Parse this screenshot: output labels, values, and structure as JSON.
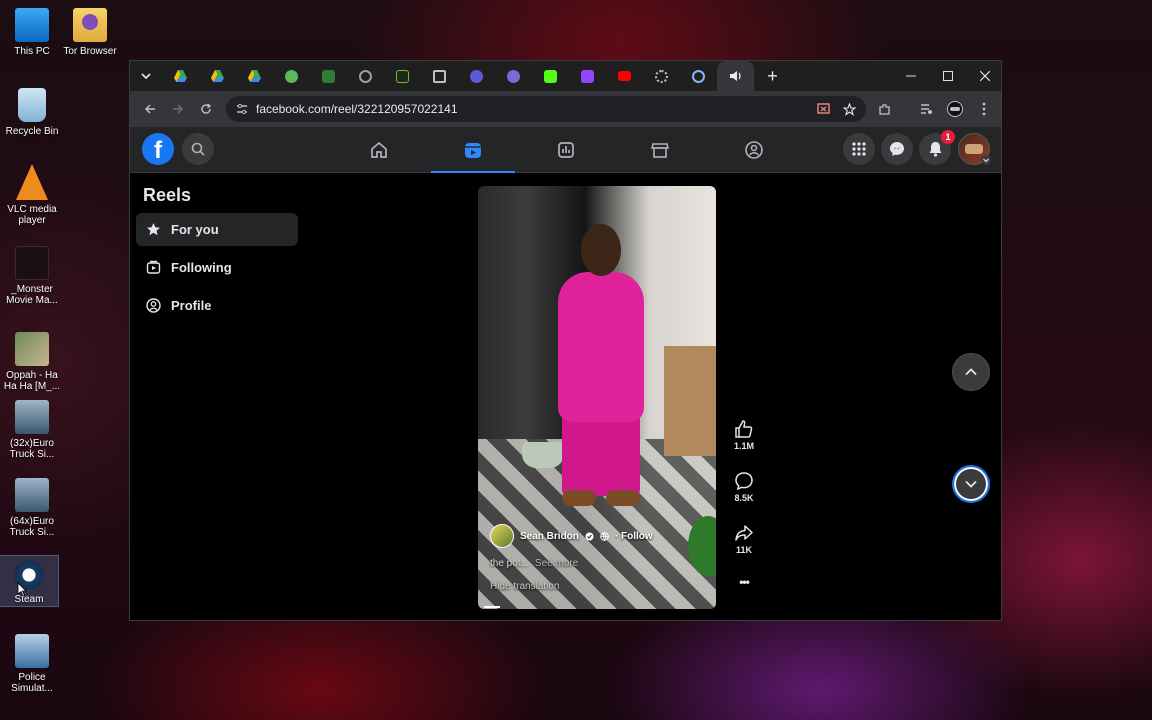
{
  "desktop": {
    "icons": [
      {
        "label": "This PC"
      },
      {
        "label": "Tor Browser"
      },
      {
        "label": "Recycle Bin"
      },
      {
        "label": "VLC media player"
      },
      {
        "label": "_Monster Movie Ma..."
      },
      {
        "label": "Oppah - Ha Ha Ha [M_..."
      },
      {
        "label": "(32x)Euro Truck Si..."
      },
      {
        "label": "(64x)Euro Truck Si..."
      },
      {
        "label": "Steam"
      },
      {
        "label": "Police Simulat..."
      }
    ]
  },
  "browser": {
    "tabs": [
      {
        "icon": "chevron-down-icon"
      },
      {
        "icon": "drive-icon",
        "color": "#34a853"
      },
      {
        "icon": "drive-icon",
        "color": "#fbbc04"
      },
      {
        "icon": "drive-icon",
        "color": "#4285f4"
      },
      {
        "icon": "globe-icon",
        "color": "#5cb85c"
      },
      {
        "icon": "st-icon",
        "color": "#2e7d32"
      },
      {
        "icon": "link-icon",
        "color": "#9aa0a6"
      },
      {
        "icon": "leaf-icon",
        "color": "#7cb342"
      },
      {
        "icon": "screen-icon",
        "color": "#bdc1c6"
      },
      {
        "icon": "app-icon",
        "color": "#5b5bd6"
      },
      {
        "icon": "app-icon",
        "color": "#7a6ad8"
      },
      {
        "icon": "k-icon",
        "color": "#53fc18"
      },
      {
        "icon": "twitch-icon",
        "color": "#9146ff"
      },
      {
        "icon": "youtube-icon",
        "color": "#ff0000"
      },
      {
        "icon": "loader-icon",
        "color": "#bdc1c6"
      },
      {
        "icon": "link-off-icon",
        "color": "#8ab4f8"
      },
      {
        "icon": "speaker-icon",
        "color": "#e8eaed"
      }
    ],
    "new_tab_label": "+",
    "url": "facebook.com/reel/322120957022141"
  },
  "facebook": {
    "brand_color": "#1877f2",
    "logo_letter": "f",
    "notification_count": "1",
    "sidebar": {
      "title": "Reels",
      "items": [
        {
          "label": "For you",
          "icon": "star-icon"
        },
        {
          "label": "Following",
          "icon": "following-icon"
        },
        {
          "label": "Profile",
          "icon": "profile-icon"
        }
      ]
    },
    "reel": {
      "author": "Sean Bridon",
      "follow_label": "· Follow",
      "caption": "the pot...",
      "see_more": "See more",
      "hide_translation": "Hide translation",
      "likes": "1.1M",
      "comments": "8.5K",
      "shares": "11K",
      "more_label": "•••"
    }
  }
}
